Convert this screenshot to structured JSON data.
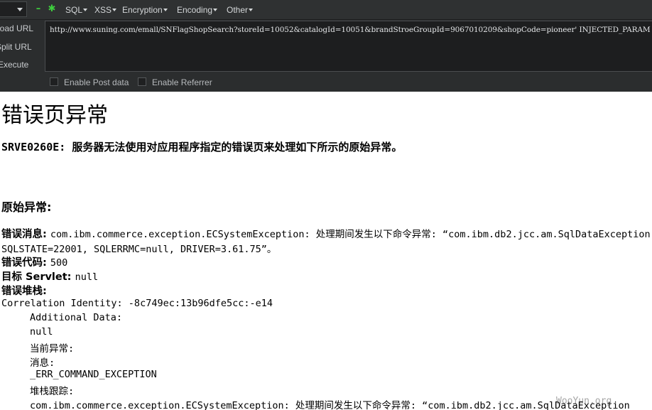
{
  "toolbar": {
    "menu": [
      "SQL",
      "XSS",
      "Encryption",
      "Encoding",
      "Other"
    ],
    "load_url": "Load URL",
    "split_url": "Split URL",
    "execute": "Execute",
    "url": "http://www.suning.com/emall/SNFlagShopSearch?storeId=10052&catalogId=10051&brandStroeGroupId=9067010209&shopCode=pioneer' INJECTED_PARAM",
    "enable_post": "Enable Post data",
    "enable_referrer": "Enable Referrer"
  },
  "page": {
    "title": "错误页异常",
    "srve_message": "SRVE0260E: 服务器无法使用对应用程序指定的错误页来处理如下所示的原始异常。",
    "original_exception": "原始异常:",
    "error_message_label": "错误消息:",
    "error_message_value": "com.ibm.commerce.exception.ECSystemException: 处理期间发生以下命令异常: “com.ibm.db2.jcc.am.SqlDataException",
    "error_message_cont": "SQLSTATE=22001, SQLERRMC=null, DRIVER=3.61.75”。",
    "error_code_label": "错误代码:",
    "error_code_value": "500",
    "target_servlet_label": "目标 Servlet:",
    "target_servlet_value": "null",
    "stack_label": "错误堆栈:",
    "correlation": "Correlation Identity: -8c749ec:13b96dfe5cc:-e14",
    "additional_data": "Additional Data:",
    "null_value": "null",
    "current_exception": "当前异常:",
    "message_label": "消息:",
    "err_command": "_ERR_COMMAND_EXCEPTION",
    "stack_trace_label": "堆栈跟踪:",
    "stack_line": "com.ibm.commerce.exception.ECSystemException: 处理期间发生以下命令异常: “com.ibm.db2.jcc.am.SqlDataException",
    "watermark": "WooYun.org"
  }
}
